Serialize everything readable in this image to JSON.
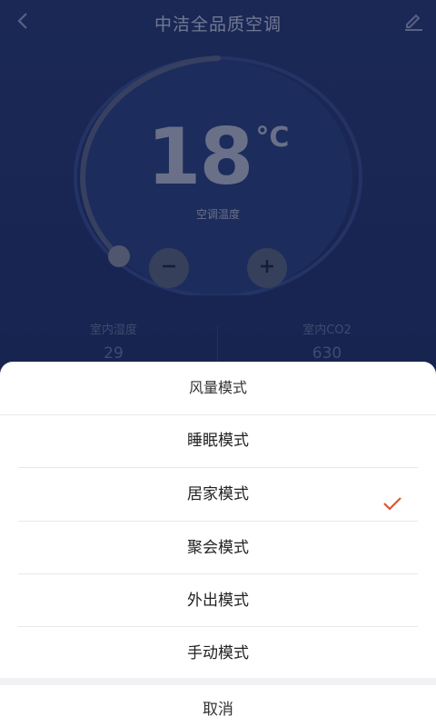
{
  "header": {
    "title": "中洁全品质空调",
    "back_icon": "chevron-left-icon",
    "edit_icon": "pencil-icon"
  },
  "thermostat": {
    "temperature": "18",
    "unit": "°C",
    "label": "空调温度",
    "minus_icon": "minus-icon",
    "plus_icon": "plus-icon"
  },
  "stats": [
    {
      "label": "室内湿度",
      "value": "29"
    },
    {
      "label": "室内CO2",
      "value": "630"
    }
  ],
  "sheet": {
    "title": "风量模式",
    "options": [
      {
        "label": "睡眠模式"
      },
      {
        "label": "居家模式"
      },
      {
        "label": "聚会模式"
      },
      {
        "label": "外出模式"
      },
      {
        "label": "手动模式"
      }
    ],
    "selected": "居家模式",
    "check_icon": "checkmark-icon",
    "check_color": "#e0532f",
    "cancel_label": "取消"
  },
  "colors": {
    "background": "#253873",
    "sheet": "#ffffff"
  }
}
